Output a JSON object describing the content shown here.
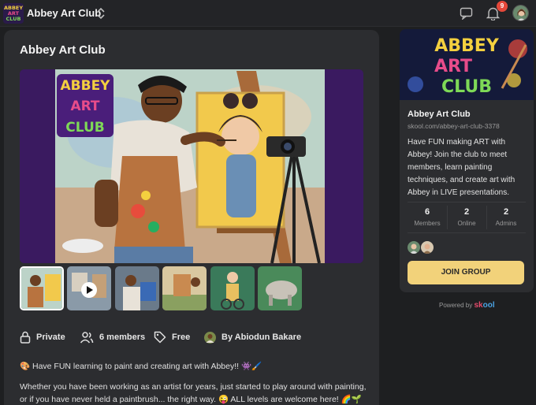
{
  "topbar": {
    "title": "Abbey Art Club",
    "notification_count": "9",
    "logo_text": [
      "ABBEY",
      "ART",
      "CLUB"
    ]
  },
  "main": {
    "title": "Abbey Art Club",
    "meta": {
      "privacy": "Private",
      "members": "6 members",
      "price": "Free",
      "owner": "By Abiodun Bakare"
    },
    "description_line1": "🎨 Have FUN learning to paint and creating art with Abbey!! 👾🖌️",
    "description_line2": "Whether you have been working as an artist for years, just started to play around with painting, or if you have never held a paintbrush... the right way. 😜 ALL levels are welcome here! 🌈🌱",
    "hero_logo_text": [
      "ABBEY",
      "ART",
      "CLUB"
    ]
  },
  "side": {
    "banner_text": [
      "ABBEY",
      "ART",
      "CLUB"
    ],
    "name": "Abbey Art Club",
    "url": "skool.com/abbey-art-club-3378",
    "description": "Have FUN making ART with Abbey! Join the club to meet members, learn painting techniques, and create art with Abbey in LIVE presentations.",
    "stats": [
      {
        "value": "6",
        "label": "Members"
      },
      {
        "value": "2",
        "label": "Online"
      },
      {
        "value": "2",
        "label": "Admins"
      }
    ],
    "join_label": "JOIN GROUP"
  },
  "footer": {
    "powered_label": "Powered by",
    "brand_a": "sk",
    "brand_b": "ool"
  },
  "colors": {
    "accent": "#f2d27a",
    "badge": "#e5483a",
    "background": "#1e1f21",
    "card": "#2c2d30"
  },
  "icons": [
    "switch-icon",
    "chat-icon",
    "bell-icon",
    "lock-icon",
    "members-icon",
    "tag-icon",
    "play-icon"
  ]
}
